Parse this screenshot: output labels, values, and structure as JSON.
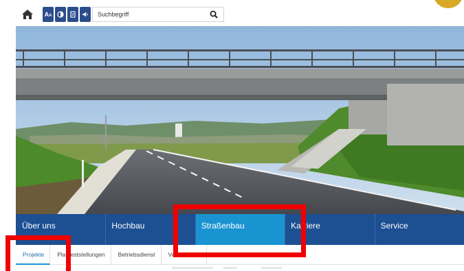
{
  "search": {
    "placeholder": "Suchbegriff"
  },
  "accessibility": {
    "font_size_label": "A",
    "font_size_sub": "A"
  },
  "icons": {
    "home": "home-icon",
    "font_size": "font-size-icon",
    "contrast": "contrast-icon",
    "document": "document-icon",
    "audio": "speaker-icon",
    "search": "search-icon"
  },
  "main_nav": {
    "items": [
      {
        "label": "Über uns"
      },
      {
        "label": "Hochbau"
      },
      {
        "label": "Straßenbau"
      },
      {
        "label": "Karriere"
      },
      {
        "label": "Service"
      }
    ],
    "active": "Straßenbau"
  },
  "sub_nav": {
    "items": [
      {
        "label": "Projekte"
      },
      {
        "label": "Planfeststellungen"
      },
      {
        "label": "Betriebsdienst"
      },
      {
        "label": "Verkehrsinfo"
      }
    ],
    "active": "Projekte"
  },
  "colors": {
    "nav_bg": "#1d4f93",
    "nav_active": "#1a93d1",
    "accessibility_btn": "#2b4d8c",
    "highlight": "#f00000"
  }
}
